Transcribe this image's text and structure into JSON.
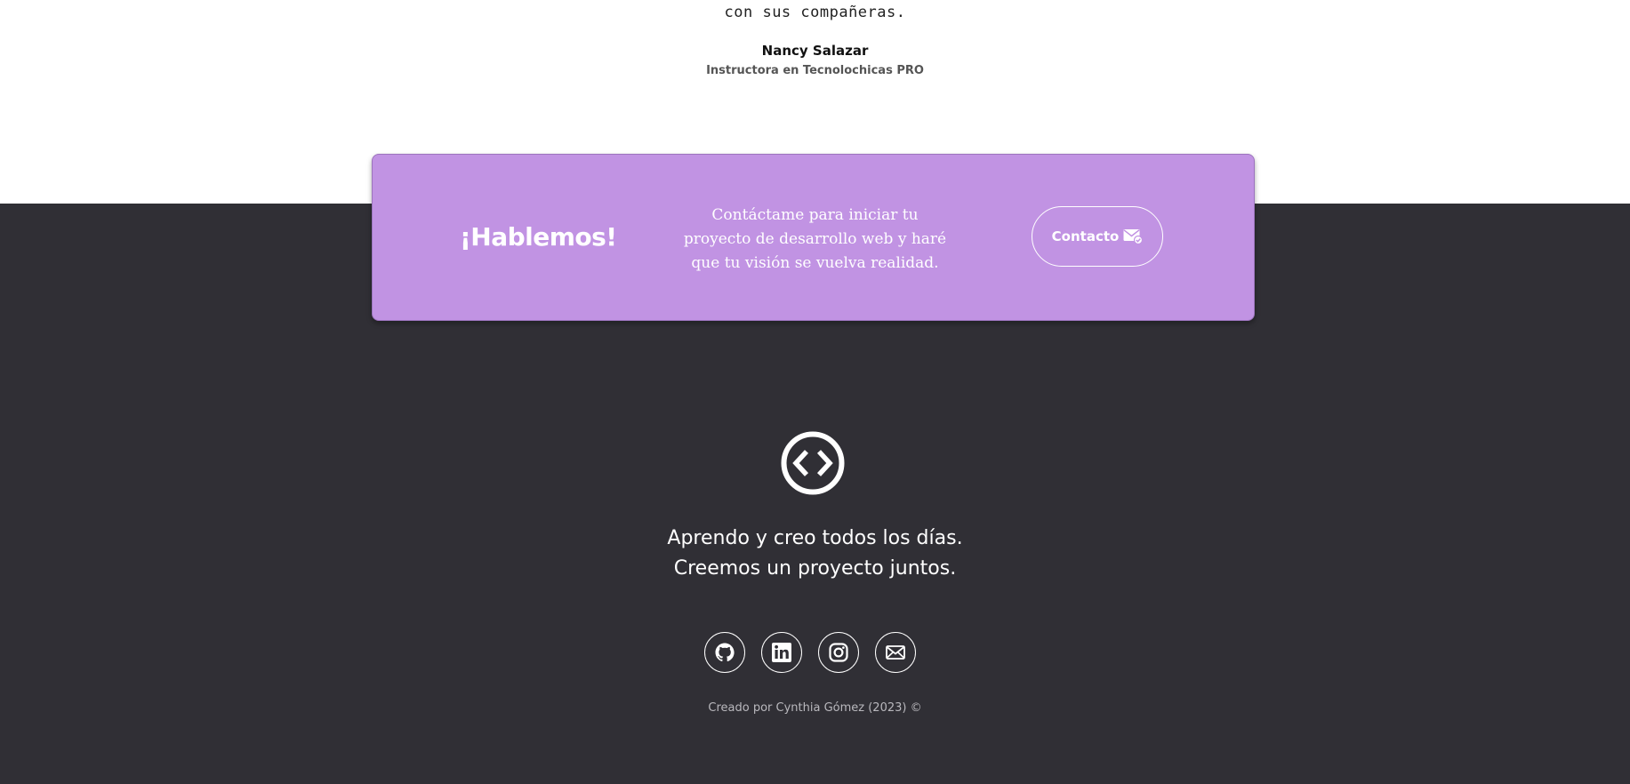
{
  "testimonial": {
    "quote_tail": "con sus compañeras.",
    "author_name": "Nancy Salazar",
    "author_role": "Instructora en Tecnolochicas PRO"
  },
  "cta": {
    "title": "¡Hablemos!",
    "text": "Contáctame para iniciar tu proyecto de desarrollo web y haré que tu visión se vuelva realidad.",
    "button_label": "Contacto",
    "button_icon": "envelope-check-icon",
    "bg_color": "#c193e3"
  },
  "footer": {
    "logo_icon": "code-brackets-icon",
    "tagline_line1": "Aprendo y creo todos los días.",
    "tagline_line2": "Creemos un proyecto juntos.",
    "social": [
      {
        "name": "github",
        "icon": "github-icon"
      },
      {
        "name": "linkedin",
        "icon": "linkedin-icon"
      },
      {
        "name": "instagram",
        "icon": "instagram-icon"
      },
      {
        "name": "email",
        "icon": "envelope-icon"
      }
    ],
    "copyright": "Creado por Cynthia Gómez (2023) ©",
    "bg_color": "#302f35"
  }
}
